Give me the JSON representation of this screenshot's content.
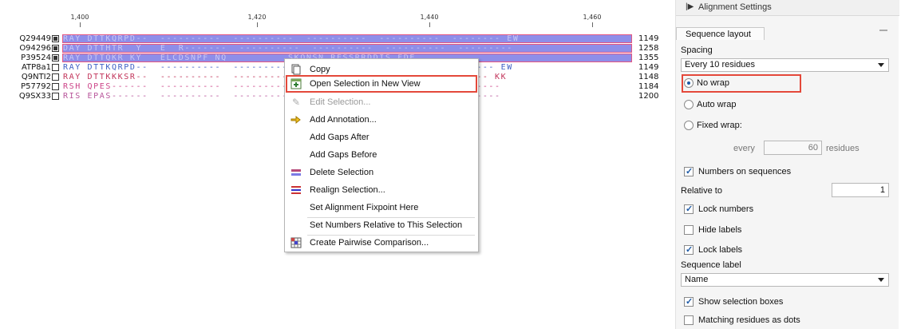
{
  "ruler": {
    "ticks": [
      "1,400",
      "1,420",
      "1,440",
      "1,460"
    ]
  },
  "sequences": [
    {
      "name": "Q29449",
      "checked": true,
      "residues": "RAY DTTKQRPD--  ----------  ----------  ----------  ----------  -------- EW",
      "end": "1149"
    },
    {
      "name": "O94296",
      "checked": true,
      "residues": "DAY DTTHTR  Y   E  R-------  ----------  ----------  ----------  ---------",
      "end": "1258"
    },
    {
      "name": "P39524",
      "checked": true,
      "residues": "RAY DTTQKR KY   ELCDSNPF NQ          SKQNSN RFSSRRDDIS FDE",
      "end": "1355"
    },
    {
      "name": "ATP8a1",
      "checked": false,
      "residues": "RAY DTTKQRPD--  ----------  ----------  ----------  ----------  ------- EW",
      "end": "1149"
    },
    {
      "name": "Q9NTI2",
      "checked": false,
      "residues": "RAY DTTKKKSR--  ----------  ----------  ----------  ----------  ------ KK",
      "end": "1148"
    },
    {
      "name": "P57792",
      "checked": false,
      "residues": "RSH QPES------  ----------  ----------  ----------  ----------  --------",
      "end": "1184"
    },
    {
      "name": "Q9SX33",
      "checked": false,
      "residues": "RIS EPAS------  ----------  ----------  ----------  ----------  --------",
      "end": "1200"
    }
  ],
  "context_menu": {
    "items": [
      {
        "label": "Copy",
        "icon": "copy-icon",
        "disabled": false
      },
      {
        "label": "Open Selection in New View",
        "icon": "new-view-icon",
        "disabled": false
      },
      {
        "label": "Edit Selection...",
        "icon": "pencil-icon",
        "disabled": true
      },
      {
        "label": "Add Annotation...",
        "icon": "annotation-icon",
        "disabled": false
      },
      {
        "label": "Add Gaps After",
        "icon": "",
        "disabled": false
      },
      {
        "label": "Add Gaps Before",
        "icon": "",
        "disabled": false
      },
      {
        "label": "Delete Selection",
        "icon": "delete-selection-icon",
        "disabled": false
      },
      {
        "label": "Realign Selection...",
        "icon": "realign-icon",
        "disabled": false
      },
      {
        "label": "Set Alignment Fixpoint Here",
        "icon": "",
        "disabled": false
      },
      {
        "label": "Set Numbers Relative to This Selection",
        "icon": "",
        "disabled": false
      },
      {
        "label": "Create Pairwise Comparison...",
        "icon": "grid-icon",
        "disabled": false
      }
    ]
  },
  "panel": {
    "title": "Alignment Settings",
    "tab": "Sequence layout",
    "spacing_label": "Spacing",
    "spacing_value": "Every 10 residues",
    "wrap_options": [
      "No wrap",
      "Auto wrap",
      "Fixed wrap:"
    ],
    "wrap_selected": "No wrap",
    "every_label": "every",
    "every_value": "60",
    "residues_label": "residues",
    "numbers_on_sequences": "Numbers on sequences",
    "relative_to_label": "Relative to",
    "relative_to_value": "1",
    "lock_numbers": "Lock numbers",
    "hide_labels": "Hide labels",
    "lock_labels": "Lock labels",
    "sequence_label_label": "Sequence label",
    "sequence_label_value": "Name",
    "show_selection_boxes": "Show selection boxes",
    "matching_residues": "Matching residues as dots"
  },
  "colors": {
    "highlight_red": "#e4483a",
    "selection_fill": "#7b7be6",
    "radio_accent": "#1d5aa6"
  }
}
